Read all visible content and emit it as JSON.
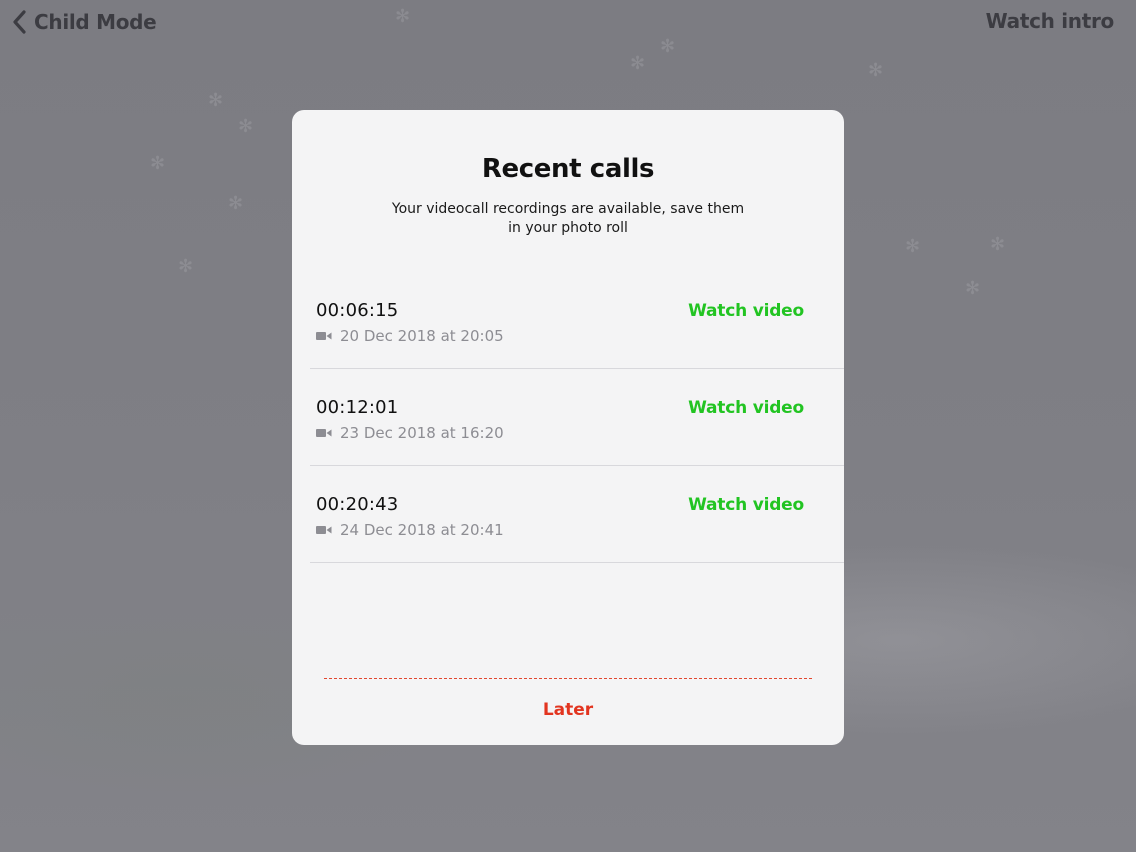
{
  "topbar": {
    "back_label": "Child Mode",
    "intro_label": "Watch intro"
  },
  "modal": {
    "title": "Recent calls",
    "subtitle": "Your videocall recordings are available, save them in your photo roll",
    "calls": [
      {
        "duration": "00:06:15",
        "date": "20 Dec 2018 at 20:05",
        "action": "Watch video"
      },
      {
        "duration": "00:12:01",
        "date": "23 Dec 2018 at 16:20",
        "action": "Watch video"
      },
      {
        "duration": "00:20:43",
        "date": "24 Dec 2018 at 20:41",
        "action": "Watch video"
      }
    ],
    "later_label": "Later"
  },
  "icons": {
    "back": "chevron-left-icon",
    "camera": "video-camera-icon"
  },
  "colors": {
    "accent_green": "#22c422",
    "accent_red": "#e2341f",
    "overlay": "#7e7e83",
    "modal_bg": "#f4f4f5"
  }
}
